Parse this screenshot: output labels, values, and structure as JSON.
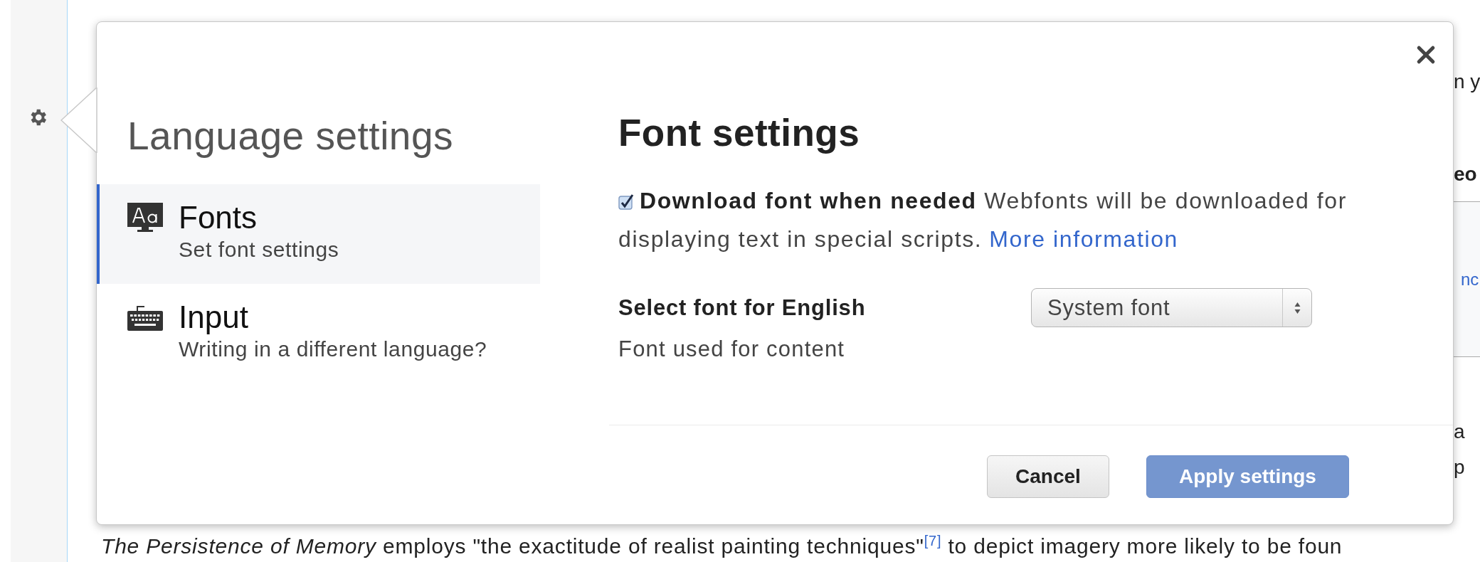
{
  "dialog": {
    "title": "Language settings",
    "sections": [
      {
        "kind": "fonts",
        "label": "Fonts",
        "description": "Set font settings",
        "selected": true
      },
      {
        "kind": "input",
        "label": "Input",
        "description": "Writing in a different language?",
        "selected": false
      }
    ],
    "panel": {
      "title": "Font settings",
      "download": {
        "checked": true,
        "text": "**Download font when needed** Webfonts will be downloaded for displaying text in special scripts.",
        "link": "More information"
      },
      "font_select": {
        "label": "Select font for English",
        "hint": "Font used for content",
        "value": "System font"
      }
    },
    "buttons": [
      {
        "label": "Cancel",
        "kind": "secondary",
        "disabled": false
      },
      {
        "label": "Apply settings",
        "kind": "primary",
        "disabled": true
      }
    ]
  },
  "article": {
    "fragments": [
      {
        "text": "n y",
        "kind": "plain"
      },
      {
        "text": "eo",
        "kind": "bold"
      },
      {
        "text": "nc",
        "kind": "link"
      },
      {
        "text": "a",
        "kind": "plain"
      },
      {
        "text": "p",
        "kind": "plain"
      }
    ],
    "paragraph": "*The Persistence of Memory* employs \"the exactitude of realist painting techniques\"$^{[7]}$ to depict imagery more likely to be foun"
  }
}
